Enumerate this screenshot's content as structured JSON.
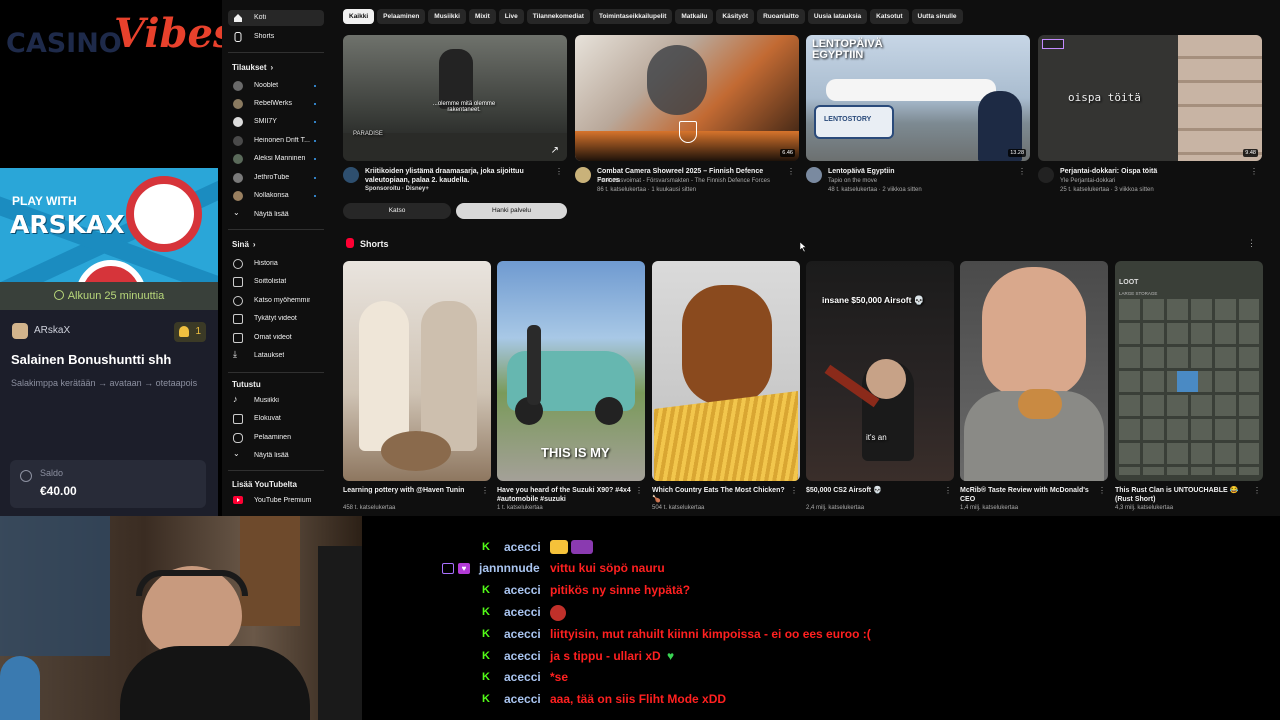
{
  "overlay": {
    "logo_casino": "CASINO",
    "logo_vibes": "Vibes",
    "promo_play_with": "PLAY WITH",
    "promo_streamer": "ARSKAX",
    "timer_text": "Alkuun 25 minuuttia",
    "user_name": "ARskaX",
    "participant_count": "1",
    "promo_title": "Salainen Bonushuntti shh",
    "promo_description": "Salakimppa kerätään → avataan → otetaapois",
    "balance_label": "Saldo",
    "balance_value": "€40.00",
    "colors": {
      "accent": "#e8412c",
      "banner": "#2aa6d8",
      "timer_text": "#b8d77a"
    }
  },
  "yt_sidebar": {
    "top_items": [
      {
        "label": "Koti",
        "icon": "home-icon"
      },
      {
        "label": "Shorts",
        "icon": "shorts-icon"
      }
    ],
    "subscriptions_heading": "Tilaukset",
    "subscriptions": [
      {
        "label": "Nooblet"
      },
      {
        "label": "RebelWerks"
      },
      {
        "label": "SMII7Y"
      },
      {
        "label": "Heinonen Drift T..."
      },
      {
        "label": "Aleksi Manninen"
      },
      {
        "label": "JethroTube"
      },
      {
        "label": "Nollakonsa"
      }
    ],
    "show_more_1": "Näytä lisää",
    "you_heading": "Sinä",
    "you_items": [
      {
        "label": "Historia",
        "icon": "history-icon"
      },
      {
        "label": "Soittolistat",
        "icon": "playlists-icon"
      },
      {
        "label": "Katso myöhemmin",
        "icon": "watch-later-icon"
      },
      {
        "label": "Tykätyt videot",
        "icon": "like-icon"
      },
      {
        "label": "Omat videot",
        "icon": "my-videos-icon"
      },
      {
        "label": "Lataukset",
        "icon": "download-icon"
      }
    ],
    "explore_heading": "Tutustu",
    "explore_items": [
      {
        "label": "Musiikki",
        "icon": "music-icon"
      },
      {
        "label": "Elokuvat",
        "icon": "movies-icon"
      },
      {
        "label": "Pelaaminen",
        "icon": "gaming-icon"
      }
    ],
    "show_more_2": "Näytä lisää",
    "more_heading": "Lisää YouTubelta",
    "more_items": [
      {
        "label": "YouTube Premium",
        "icon": "youtube-premium-icon"
      }
    ]
  },
  "chips": [
    "Kaikki",
    "Pelaaminen",
    "Musiikki",
    "Mixit",
    "Live",
    "Tilannekomediat",
    "Toimintaseikkailupelit",
    "Matkailu",
    "Käsityöt",
    "Ruoanlaitto",
    "Uusia latauksia",
    "Katsotut",
    "Uutta sinulle"
  ],
  "videos": [
    {
      "title": "Kriitikoiden ylistämä draamasarja, joka sijoittuu valeutopiaan, palaa 2. kaudella.",
      "line2": "Sponsoroitu · Disney+",
      "line3": "",
      "overlay": "...olemme mitä olemme rakentaneet.",
      "brand": "PARADISE",
      "duration": ""
    },
    {
      "title": "Combat Camera Showreel 2025 – Finnish Defence Forces",
      "line2": "Puolustusvoimat - Försvarsmakten - The Finnish Defence Forces",
      "line3": "86 t. katselukertaa · 1 kuukausi sitten",
      "overlay": "",
      "brand": "",
      "duration": "6.46"
    },
    {
      "title": "Lentopäivä Egyptiin",
      "line2": "Tapio on the move",
      "line3": "48 t. katselukertaa · 2 viikkoa sitten",
      "overlay": "LENTOPÄIVÄ EGYPTIIN",
      "brand": "LENTOSTORY",
      "duration": "13.28"
    },
    {
      "title": "Perjantai-dokkari: Oispa töitä",
      "line2": "Yle Perjantai-dokkari",
      "line3": "25 t. katselukertaa · 3 viikkoa sitten",
      "overlay": "oispa töitä",
      "brand": "",
      "duration": "9.48"
    }
  ],
  "ad_buttons": {
    "watch": "Katso",
    "get_service": "Hanki palvelu"
  },
  "shorts_heading": "Shorts",
  "shorts": [
    {
      "title": "Learning pottery with @Haven Tunin",
      "views": "458 t. katselukertaa",
      "overlay": ""
    },
    {
      "title": "Have you heard of the Suzuki X90? #4x4 #automobile #suzuki",
      "views": "1 t. katselukertaa",
      "overlay": "THIS IS MY"
    },
    {
      "title": "Which Country Eats The Most Chicken? 🍗",
      "views": "504 t. katselukertaa",
      "overlay": ""
    },
    {
      "title": "$50,000 CS2 Airsoft 💀",
      "views": "2,4 milj. katselukertaa",
      "overlay": "insane $50,000 Airsoft 💀",
      "overlay2": "it's an"
    },
    {
      "title": "McRib® Taste Review with McDonald's CEO",
      "views": "1,4 milj. katselukertaa",
      "overlay": ""
    },
    {
      "title": "This Rust Clan is UNTOUCHABLE 😂 (Rust Short)",
      "views": "4,3 milj. katselukertaa",
      "overlay": "LOOT",
      "overlay2": "LARGE STORAGE"
    }
  ],
  "chat": [
    {
      "user": "acecci",
      "message": "",
      "badge": "kick",
      "emote": "popcorn-emote"
    },
    {
      "user": "jannnnude",
      "message": "vittu kui söpö nauru",
      "badge": "twitch",
      "emote": ""
    },
    {
      "user": "acecci",
      "message": "pitikös ny sinne hypätä?",
      "badge": "kick",
      "emote": ""
    },
    {
      "user": "acecci",
      "message": "",
      "badge": "kick",
      "emote": "devil-emote"
    },
    {
      "user": "acecci",
      "message": "liittyisin, mut rahuilt kiinni kimpoissa - ei oo ees euroo :(",
      "badge": "kick",
      "emote": ""
    },
    {
      "user": "acecci",
      "message": "ja s tippu - ullari xD",
      "badge": "kick",
      "emote": "green-heart-emote"
    },
    {
      "user": "acecci",
      "message": "*se",
      "badge": "kick",
      "emote": ""
    },
    {
      "user": "acecci",
      "message": "aaa, tää on siis Fliht Mode xDD",
      "badge": "kick",
      "emote": ""
    }
  ]
}
